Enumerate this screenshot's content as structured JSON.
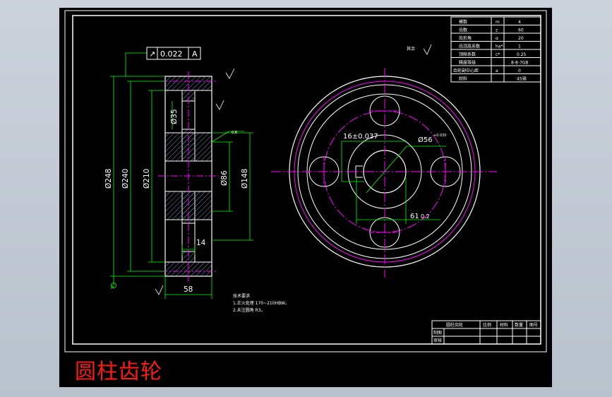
{
  "title": "圆柱齿轮",
  "colors": {
    "background": "#000000",
    "frame": "#ffffff",
    "dimension": "#00ff00",
    "centerline": "#ff00ff",
    "hatch": "#6f8fbf",
    "title_text": "#ff1a1a"
  },
  "drawing": {
    "tolerance_frame": {
      "symbol": "↗",
      "value": "0.022",
      "datum": "A"
    },
    "roughness_note": "其余",
    "section_dims": {
      "d248": "Ø248",
      "d240": "Ø240",
      "d210": "Ø210",
      "d35": "Ø35",
      "d86": "Ø86",
      "d148": "Ø148",
      "w14": "14",
      "w58": "58",
      "datum_a": "A",
      "chamfer": "0.8"
    },
    "front_dims": {
      "key_width": "16±0.037",
      "bore": "Ø56",
      "bore_tol": "+0.030",
      "key_depth": "61",
      "key_depth_tol": "0.2"
    },
    "tech_requirements": {
      "heading": "技术要求",
      "line1": "1.正火处理 170~210HBW。",
      "line2": "2.未注圆角 R3。"
    },
    "param_table": [
      {
        "label": "模数",
        "symbol": "m",
        "value": "4"
      },
      {
        "label": "齿数",
        "symbol": "z",
        "value": "60"
      },
      {
        "label": "齿形角",
        "symbol": "α",
        "value": "20"
      },
      {
        "label": "齿顶高系数",
        "symbol": "ha*",
        "value": "1"
      },
      {
        "label": "顶隙系数",
        "symbol": "c*",
        "value": "0.25"
      },
      {
        "label": "精度等级",
        "symbol": "",
        "value": "8-8-7GB"
      },
      {
        "label": "齿轮副中心距",
        "symbol": "a",
        "value": "0"
      },
      {
        "label": "材料",
        "symbol": "",
        "value": "45钢"
      }
    ],
    "title_block": {
      "name": "圆柱齿轮",
      "headers": [
        "比例",
        "材料",
        "数量",
        "图号"
      ],
      "row2": "制图",
      "row3": "审核"
    }
  }
}
